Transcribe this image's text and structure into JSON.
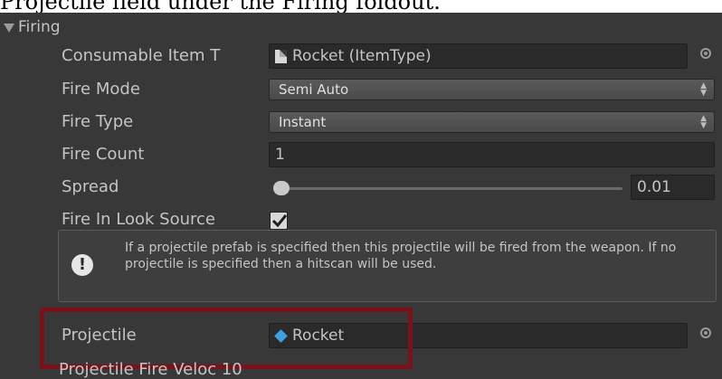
{
  "caption": "Projectile field under the Firing foldout.",
  "foldout": {
    "label": "Firing"
  },
  "rows": {
    "consumable": {
      "label": "Consumable Item T",
      "value": "Rocket (ItemType)",
      "icon": "scriptable-object-icon"
    },
    "fire_mode": {
      "label": "Fire Mode",
      "value": "Semi Auto"
    },
    "fire_type": {
      "label": "Fire Type",
      "value": "Instant"
    },
    "fire_count": {
      "label": "Fire Count",
      "value": "1"
    },
    "spread": {
      "label": "Spread",
      "value": "0.01",
      "slider_fraction": 0.0
    },
    "fire_in_look": {
      "label": "Fire In Look Source",
      "checked": true
    },
    "projectile": {
      "label": "Projectile",
      "value": "Rocket",
      "icon": "prefab-icon"
    },
    "projectile_fire_velocity": {
      "label": "Projectile Fire Veloc 10"
    }
  },
  "help": {
    "text": "If a projectile prefab is specified then this projectile will be fired from the weapon. If no projectile is specified then a hitscan will be used."
  },
  "colors": {
    "highlight": "#7a1219",
    "panel_bg": "#383838"
  }
}
